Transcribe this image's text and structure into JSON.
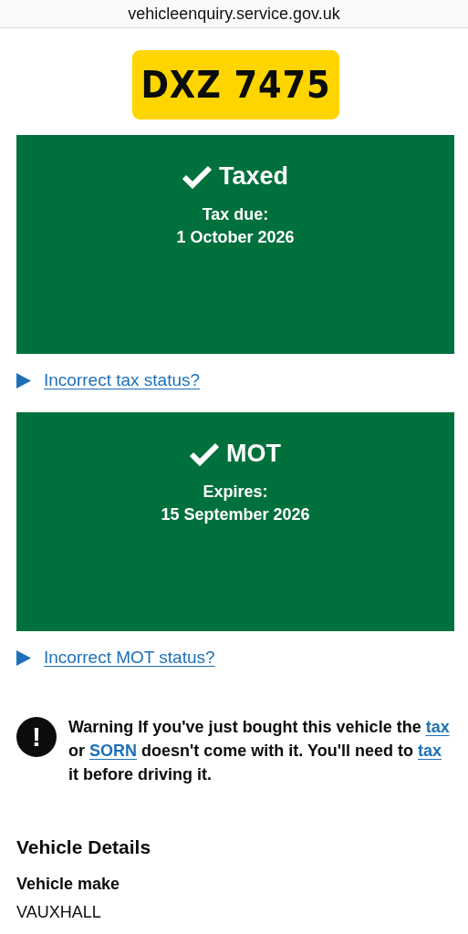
{
  "address_bar": {
    "url": "vehicleenquiry.service.gov.uk"
  },
  "plate": {
    "registration": "DXZ 7475"
  },
  "status_panels": [
    {
      "title": "Taxed",
      "ok": true,
      "label": "Tax due:",
      "date": "1 October 2026",
      "details_link": "Incorrect tax status?"
    },
    {
      "title": "MOT",
      "ok": true,
      "label": "Expires:",
      "date": "15 September 2026",
      "details_link": "Incorrect MOT status?"
    }
  ],
  "warning": {
    "icon": "!",
    "parts": [
      {
        "kind": "text",
        "text": "Warning If you've just bought this vehicle the "
      },
      {
        "kind": "link",
        "text": "tax"
      },
      {
        "kind": "text",
        "text": " or "
      },
      {
        "kind": "link",
        "text": "SORN"
      },
      {
        "kind": "text",
        "text": " doesn't come with it. You'll need to "
      },
      {
        "kind": "link",
        "text": "tax"
      },
      {
        "kind": "text",
        "text": " it before driving it."
      }
    ]
  },
  "vehicle_details": {
    "heading": "Vehicle Details",
    "fields": [
      {
        "label": "Vehicle make",
        "value": "VAUXHALL"
      }
    ]
  }
}
